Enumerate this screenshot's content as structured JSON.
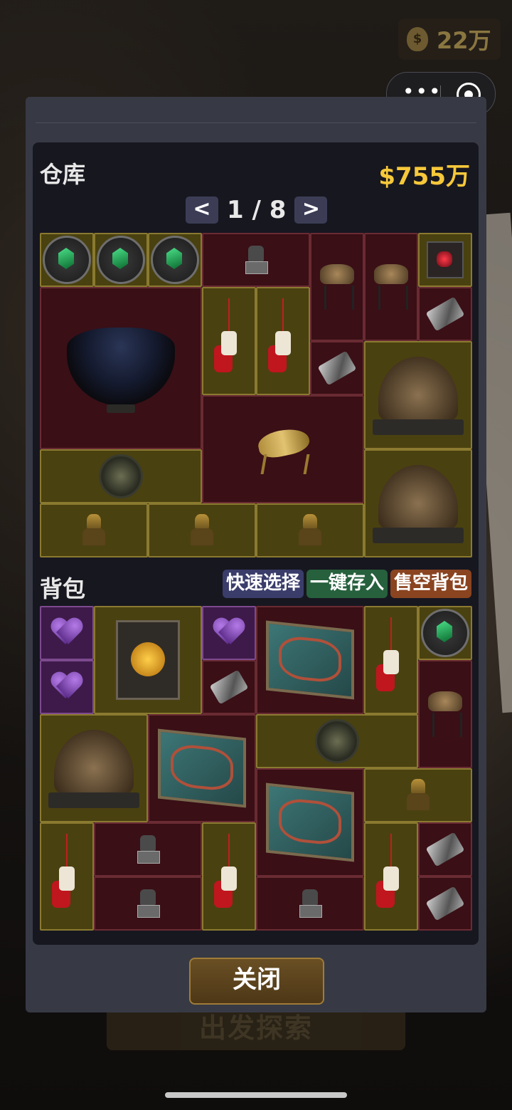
{
  "background": {
    "coins_amount": "22万",
    "bottom_button_text": "出发探索"
  },
  "capsule": {
    "more_label": "•••"
  },
  "warehouse": {
    "title": "仓库",
    "total_value": "$755万",
    "pager": {
      "prev": "<",
      "page": "1 / 8",
      "next": ">"
    },
    "items": [
      {
        "icon": "green-gem-medallion-icon",
        "rarity": "gold"
      },
      {
        "icon": "green-gem-medallion-icon",
        "rarity": "gold"
      },
      {
        "icon": "green-gem-medallion-icon",
        "rarity": "gold"
      },
      {
        "icon": "stone-seal-icon",
        "rarity": "red"
      },
      {
        "icon": "crown-on-stand-icon",
        "rarity": "red"
      },
      {
        "icon": "crown-on-stand-icon",
        "rarity": "red"
      },
      {
        "icon": "red-gem-icon",
        "rarity": "gold"
      },
      {
        "icon": "starry-bowl-icon",
        "rarity": "red"
      },
      {
        "icon": "jade-pendant-icon",
        "rarity": "gold"
      },
      {
        "icon": "jade-pendant-icon",
        "rarity": "gold"
      },
      {
        "icon": "metal-scrap-icon",
        "rarity": "red"
      },
      {
        "icon": "metal-scrap-icon",
        "rarity": "red"
      },
      {
        "icon": "jeweled-crown-icon",
        "rarity": "gold"
      },
      {
        "icon": "bronze-horse-icon",
        "rarity": "red"
      },
      {
        "icon": "turtle-shell-icon",
        "rarity": "gold"
      },
      {
        "icon": "jeweled-crown-icon",
        "rarity": "gold"
      },
      {
        "icon": "golden-statue-icon",
        "rarity": "gold"
      },
      {
        "icon": "golden-statue-icon",
        "rarity": "gold"
      },
      {
        "icon": "golden-statue-icon",
        "rarity": "gold"
      }
    ]
  },
  "backpack": {
    "title": "背包",
    "quick_select": "快速选择",
    "store_all": "一键存入",
    "sell_all": "售空背包",
    "items": [
      {
        "icon": "purple-heart-icon",
        "rarity": "purple"
      },
      {
        "icon": "golden-relic-icon",
        "rarity": "gold"
      },
      {
        "icon": "purple-heart-icon",
        "rarity": "purple"
      },
      {
        "icon": "dragon-panel-icon",
        "rarity": "red"
      },
      {
        "icon": "jade-pendant-icon",
        "rarity": "gold"
      },
      {
        "icon": "green-gem-medallion-icon",
        "rarity": "gold"
      },
      {
        "icon": "purple-heart-icon",
        "rarity": "purple"
      },
      {
        "icon": "metal-scrap-icon",
        "rarity": "red"
      },
      {
        "icon": "crown-on-stand-icon",
        "rarity": "red"
      },
      {
        "icon": "jeweled-crown-icon",
        "rarity": "gold"
      },
      {
        "icon": "dragon-panel-icon",
        "rarity": "red"
      },
      {
        "icon": "turtle-shell-icon",
        "rarity": "gold"
      },
      {
        "icon": "dragon-panel-icon",
        "rarity": "red"
      },
      {
        "icon": "golden-statue-icon",
        "rarity": "gold"
      },
      {
        "icon": "jade-pendant-icon",
        "rarity": "gold"
      },
      {
        "icon": "stone-seal-icon",
        "rarity": "red"
      },
      {
        "icon": "jade-pendant-icon",
        "rarity": "gold"
      },
      {
        "icon": "jade-pendant-icon",
        "rarity": "gold"
      },
      {
        "icon": "metal-scrap-icon",
        "rarity": "red"
      },
      {
        "icon": "stone-seal-icon",
        "rarity": "red"
      },
      {
        "icon": "stone-seal-icon",
        "rarity": "red"
      },
      {
        "icon": "metal-scrap-icon",
        "rarity": "red"
      }
    ]
  },
  "close_label": "关闭",
  "colors": {
    "modal_bg": "#373a45",
    "panel_bg": "#171720",
    "gold_text": "#f6c83a",
    "rarity_red": "#3a0f16",
    "rarity_gold": "#4a4110",
    "rarity_purple": "#3e1a4a",
    "close_button": "#5a4020"
  }
}
